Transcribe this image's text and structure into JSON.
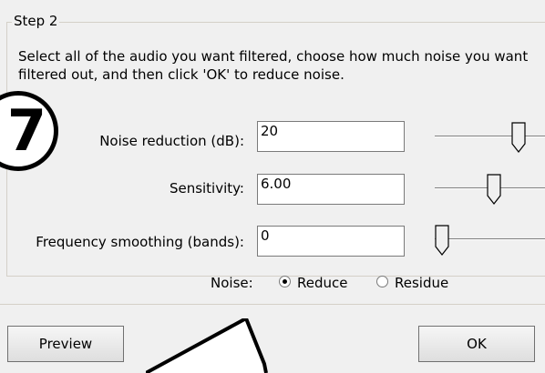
{
  "group": {
    "title": "Step 2",
    "instructions_line1": "Select all of the audio you want filtered, choose how much noise you want",
    "instructions_line2": "filtered out, and then click 'OK' to reduce noise."
  },
  "fields": [
    {
      "label": "Noise reduction (dB):",
      "value": "20",
      "slider_level": 0.68
    },
    {
      "label": "Sensitivity:",
      "value": "6.00",
      "slider_level": 0.46
    },
    {
      "label": "Frequency smoothing (bands):",
      "value": "0",
      "slider_level": 0.0
    }
  ],
  "noise": {
    "label": "Noise:",
    "options": [
      "Reduce",
      "Residue"
    ],
    "selected": "Reduce"
  },
  "buttons": {
    "preview": "Preview",
    "ok": "OK"
  },
  "annotation": {
    "step_number": "7"
  }
}
